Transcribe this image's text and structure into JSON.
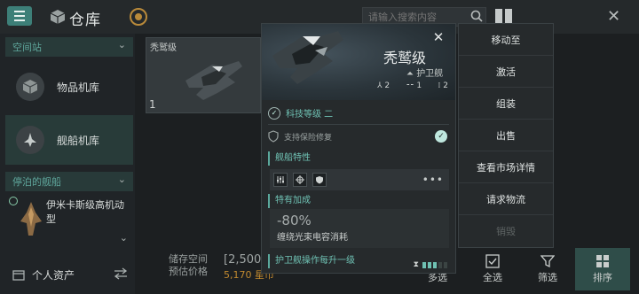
{
  "header": {
    "title": "仓库",
    "search_placeholder": "请输入搜索内容"
  },
  "sidebar": {
    "section_station": "空间站",
    "items": [
      {
        "label": "物品机库"
      },
      {
        "label": "舰船机库"
      }
    ],
    "section_docked": "停泊的舰船",
    "docked_ship_name": "伊米卡斯级高机动型",
    "personal_assets": "个人资产"
  },
  "main": {
    "ship_card": {
      "title": "秃鹫级",
      "quantity": "1"
    },
    "storage_label_1": "储存空间",
    "storage_label_2": "预估价格",
    "capacity_value": "[2,500",
    "price_value": "5,170 星币",
    "bottom_buttons": [
      {
        "label": "多选"
      },
      {
        "label": "全选"
      },
      {
        "label": "筛选"
      },
      {
        "label": "排序"
      }
    ]
  },
  "popup": {
    "ship_name": "秃鹫级",
    "ship_class": "护卫舰",
    "slots": [
      {
        "icon": "turret-slot-icon",
        "value": "2"
      },
      {
        "icon": "module-slot-icon",
        "value": "1"
      },
      {
        "icon": "rig-slot-icon",
        "value": "2"
      }
    ],
    "tech_level": "科技等级 二",
    "insurance": "支持保险修复",
    "traits_header": "舰船特性",
    "special_bonus_header": "特有加成",
    "bonus_value": "-80%",
    "bonus_desc": "缠绕光束电容消耗",
    "skill_row": "护卫舰操作每升一级",
    "skill_level": 0.6
  },
  "actions": [
    {
      "label": "移动至",
      "enabled": true
    },
    {
      "label": "激活",
      "enabled": true
    },
    {
      "label": "组装",
      "enabled": true
    },
    {
      "label": "出售",
      "enabled": true
    },
    {
      "label": "查看市场详情",
      "enabled": true
    },
    {
      "label": "请求物流",
      "enabled": true
    },
    {
      "label": "销毁",
      "enabled": false
    }
  ],
  "colors": {
    "accent": "#5aa89c",
    "accent_text": "#6fc1b3",
    "menu_button": "#3d7f78",
    "price": "#c0892f"
  }
}
